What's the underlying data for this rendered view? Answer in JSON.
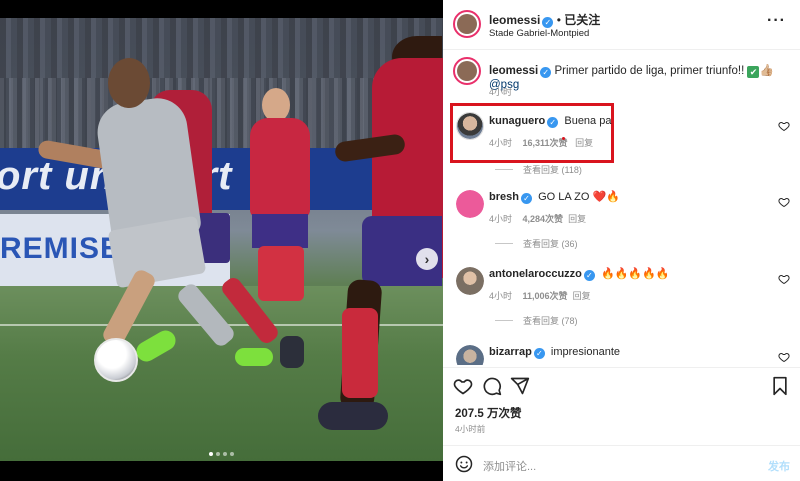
{
  "photo": {
    "banner_text": "ort unisport",
    "banner2_text": "REMISES"
  },
  "header": {
    "username": "leomessi",
    "separator": "•",
    "follow_status": "已关注",
    "location": "Stade Gabriel-Montpied",
    "more": "···"
  },
  "caption": {
    "username": "leomessi",
    "text": "Primer partido de liga, primer triunfo!! ",
    "emoji": "✔",
    "emoji_2": "👍🏼",
    "mention": "@psg",
    "time": "4小时"
  },
  "comments": [
    {
      "username": "kunaguero",
      "text": "Buena pa",
      "time": "4小时",
      "likes": "16,311次赞",
      "reply": "回复",
      "avatar_color": "#c9a58a",
      "highlighted": true
    },
    {
      "username": "bresh",
      "text": "GO LA ZO ❤️🔥",
      "time": "4小时",
      "likes": "4,284次赞",
      "reply": "回复",
      "view_replies": "查看回复 (36)",
      "avatar_color": "#ec5a9a"
    },
    {
      "username": "antonelaroccuzzo",
      "text": "🔥🔥🔥🔥🔥",
      "time": "4小时",
      "likes": "11,006次赞",
      "reply": "回复",
      "view_replies": "查看回复 (78)",
      "avatar_color": "#7b6f63"
    },
    {
      "username": "bizarrap",
      "text": "impresionante",
      "avatar_color": "#5b6e86"
    }
  ],
  "first_replies": "查看回复 (118)",
  "footer": {
    "likes": "207.5 万次赞",
    "time": "4小时前",
    "comment_placeholder": "添加评论...",
    "post_label": "发布"
  },
  "colors": {
    "verified": "#3897f0",
    "highlight": "#d9141e",
    "mention": "#00376b"
  }
}
